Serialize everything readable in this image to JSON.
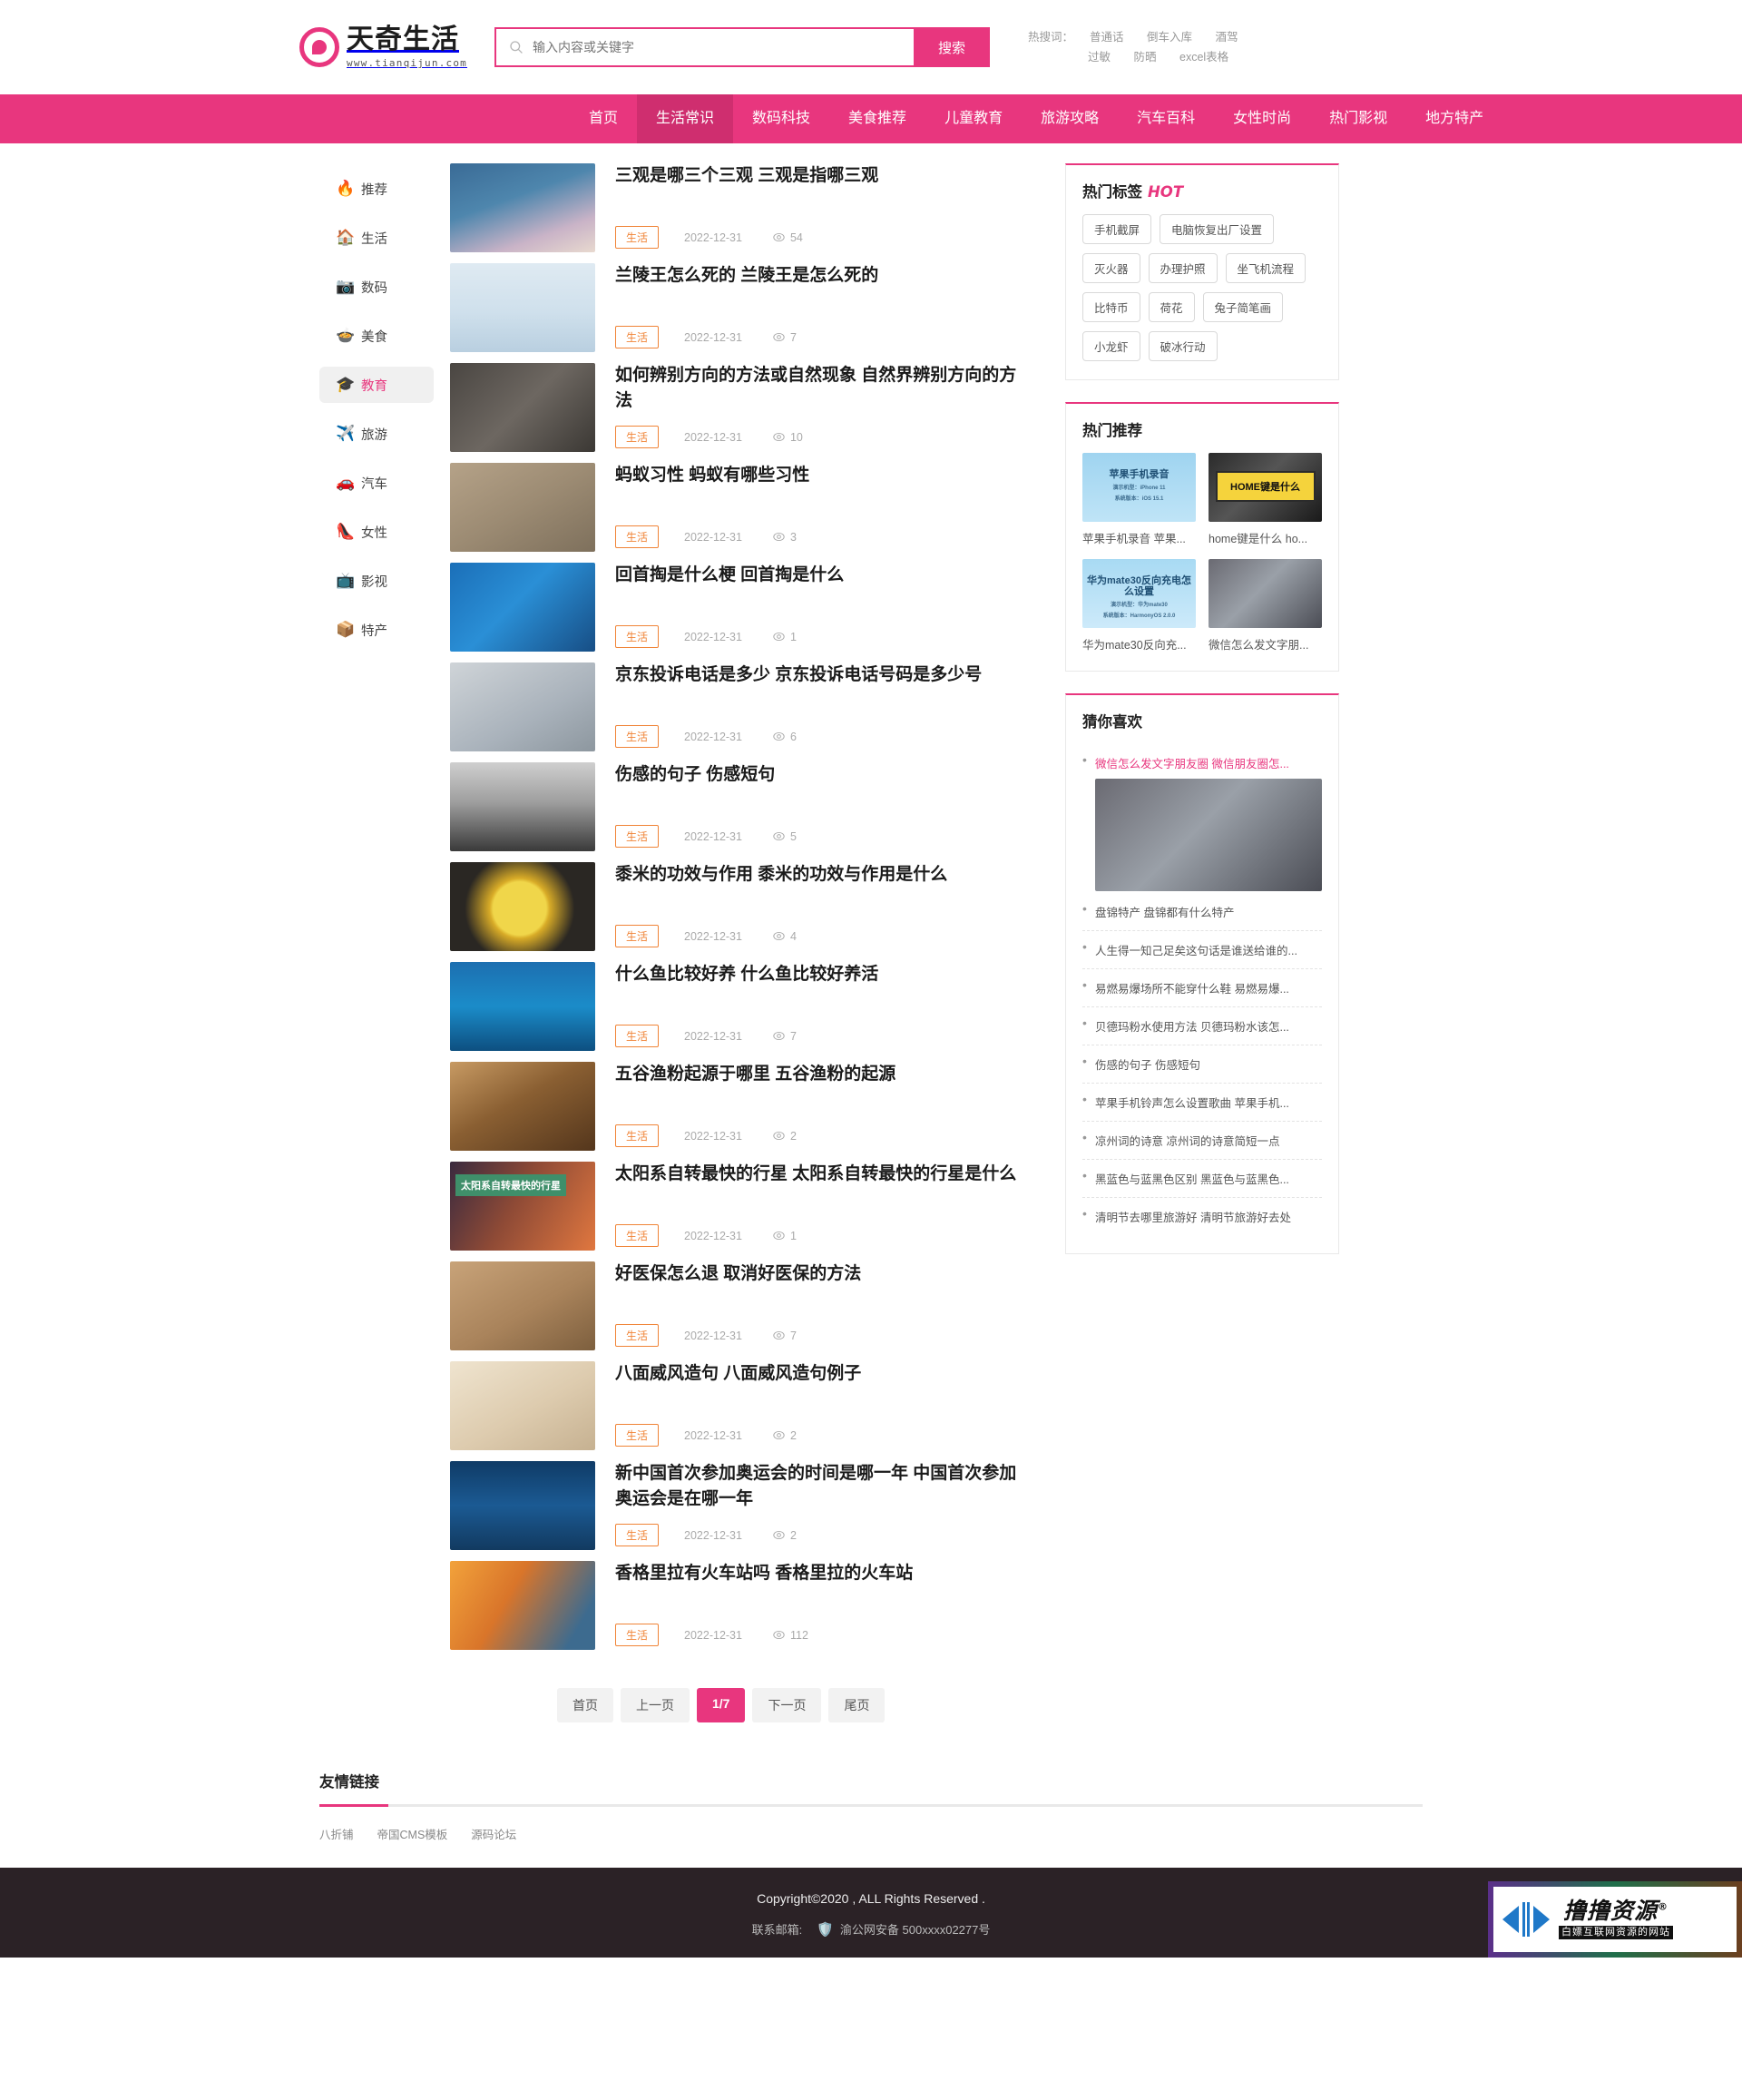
{
  "site": {
    "logo_title": "天奇生活",
    "logo_sub": "www.tianqijun.com"
  },
  "search": {
    "placeholder": "输入内容或关键字",
    "value": "",
    "button_label": "搜索"
  },
  "hotwords": {
    "label": "热搜词：",
    "row1": [
      "普通话",
      "倒车入库",
      "酒驾"
    ],
    "row2": [
      "过敏",
      "防晒",
      "excel表格"
    ]
  },
  "nav": {
    "items": [
      {
        "label": "首页",
        "active": false
      },
      {
        "label": "生活常识",
        "active": true
      },
      {
        "label": "数码科技",
        "active": false
      },
      {
        "label": "美食推荐",
        "active": false
      },
      {
        "label": "儿童教育",
        "active": false
      },
      {
        "label": "旅游攻略",
        "active": false
      },
      {
        "label": "汽车百科",
        "active": false
      },
      {
        "label": "女性时尚",
        "active": false
      },
      {
        "label": "热门影视",
        "active": false
      },
      {
        "label": "地方特产",
        "active": false
      }
    ]
  },
  "categories": [
    {
      "icon": "🔥",
      "label": "推荐",
      "active": false
    },
    {
      "icon": "🏠",
      "label": "生活",
      "active": false
    },
    {
      "icon": "📷",
      "label": "数码",
      "active": false
    },
    {
      "icon": "🍲",
      "label": "美食",
      "active": false
    },
    {
      "icon": "🎓",
      "label": "教育",
      "active": true
    },
    {
      "icon": "✈️",
      "label": "旅游",
      "active": false
    },
    {
      "icon": "🚗",
      "label": "汽车",
      "active": false
    },
    {
      "icon": "👠",
      "label": "女性",
      "active": false
    },
    {
      "icon": "📺",
      "label": "影视",
      "active": false
    },
    {
      "icon": "📦",
      "label": "特产",
      "active": false
    }
  ],
  "articles": [
    {
      "title": "三观是哪三个三观 三观是指哪三观",
      "tag": "生活",
      "date": "2022-12-31",
      "views": "54",
      "thumb": "book-blue"
    },
    {
      "title": "兰陵王怎么死的 兰陵王是怎么死的",
      "tag": "生活",
      "date": "2022-12-31",
      "views": "7",
      "thumb": "ancient-man"
    },
    {
      "title": "如何辨别方向的方法或自然现象 自然界辨别方向的方法",
      "tag": "生活",
      "date": "2022-12-31",
      "views": "10",
      "thumb": "arrows"
    },
    {
      "title": "蚂蚁习性 蚂蚁有哪些习性",
      "tag": "生活",
      "date": "2022-12-31",
      "views": "3",
      "thumb": "ant"
    },
    {
      "title": "回首掏是什么梗 回首掏是什么",
      "tag": "生活",
      "date": "2022-12-31",
      "views": "1",
      "thumb": "gaming"
    },
    {
      "title": "京东投诉电话是多少 京东投诉电话号码是多少号",
      "tag": "生活",
      "date": "2022-12-31",
      "views": "6",
      "thumb": "tech-hand"
    },
    {
      "title": "伤感的句子 伤感短句",
      "tag": "生活",
      "date": "2022-12-31",
      "views": "5",
      "thumb": "silhouette"
    },
    {
      "title": "黍米的功效与作用 黍米的功效与作用是什么",
      "tag": "生活",
      "date": "2022-12-31",
      "views": "4",
      "thumb": "millet"
    },
    {
      "title": "什么鱼比较好养 什么鱼比较好养活",
      "tag": "生活",
      "date": "2022-12-31",
      "views": "7",
      "thumb": "fish"
    },
    {
      "title": "五谷渔粉起源于哪里 五谷渔粉的起源",
      "tag": "生活",
      "date": "2022-12-31",
      "views": "2",
      "thumb": "noodle"
    },
    {
      "title": "太阳系自转最快的行星 太阳系自转最快的行星是什么",
      "tag": "生活",
      "date": "2022-12-31",
      "views": "1",
      "thumb": "planet",
      "thumb_text": "太阳系自转最快的行星"
    },
    {
      "title": "好医保怎么退 取消好医保的方法",
      "tag": "生活",
      "date": "2022-12-31",
      "views": "7",
      "thumb": "phone-apps"
    },
    {
      "title": "八面威风造句 八面威风造句例子",
      "tag": "生活",
      "date": "2022-12-31",
      "views": "2",
      "thumb": "book-leaf"
    },
    {
      "title": "新中国首次参加奥运会的时间是哪一年 中国首次参加奥运会是在哪一年",
      "tag": "生活",
      "date": "2022-12-31",
      "views": "2",
      "thumb": "medal"
    },
    {
      "title": "香格里拉有火车站吗 香格里拉的火车站",
      "tag": "生活",
      "date": "2022-12-31",
      "views": "112",
      "thumb": "train"
    }
  ],
  "pagination": {
    "first": "首页",
    "prev": "上一页",
    "current": "1/7",
    "next": "下一页",
    "last": "尾页"
  },
  "hot_tags": {
    "title": "热门标签",
    "badge": "HOT",
    "items": [
      "手机截屏",
      "电脑恢复出厂设置",
      "灭火器",
      "办理护照",
      "坐飞机流程",
      "比特币",
      "荷花",
      "兔子简笔画",
      "小龙虾",
      "破冰行动"
    ]
  },
  "hot_recs": {
    "title": "热门推荐",
    "items": [
      {
        "caption": "苹果手机录音 苹果...",
        "thumb": "iphone-record",
        "thumb_text": "苹果手机录音",
        "thumb_sub1": "演示机型：iPhone 11",
        "thumb_sub2": "系统版本：iOS 15.1"
      },
      {
        "caption": "home键是什么 ho...",
        "thumb": "home-key",
        "thumb_text": "HOME键是什么"
      },
      {
        "caption": "华为mate30反向充...",
        "thumb": "huawei",
        "thumb_text": "华为mate30反向充电怎么设置",
        "thumb_sub1": "演示机型：华为mate30",
        "thumb_sub2": "系统版本：HarmonyOS 2.0.0"
      },
      {
        "caption": "微信怎么发文字朋...",
        "thumb": "wechat-hand"
      }
    ]
  },
  "guess_like": {
    "title": "猜你喜欢",
    "items": [
      {
        "text": "微信怎么发文字朋友圈 微信朋友圈怎...",
        "highlight": true,
        "image": "wechat-hand"
      },
      {
        "text": "盘锦特产 盘锦都有什么特产",
        "highlight": false
      },
      {
        "text": "人生得一知己足矣这句话是谁送给谁的...",
        "highlight": false
      },
      {
        "text": "易燃易爆场所不能穿什么鞋 易燃易爆...",
        "highlight": false
      },
      {
        "text": "贝德玛粉水使用方法 贝德玛粉水该怎...",
        "highlight": false
      },
      {
        "text": "伤感的句子 伤感短句",
        "highlight": false
      },
      {
        "text": "苹果手机铃声怎么设置歌曲 苹果手机...",
        "highlight": false
      },
      {
        "text": "凉州词的诗意 凉州词的诗意简短一点",
        "highlight": false
      },
      {
        "text": "黑蓝色与蓝黑色区别 黑蓝色与蓝黑色...",
        "highlight": false
      },
      {
        "text": "清明节去哪里旅游好 清明节旅游好去处",
        "highlight": false
      }
    ]
  },
  "friend_links": {
    "title": "友情链接",
    "items": [
      "八折铺",
      "帝国CMS模板",
      "源码论坛"
    ]
  },
  "footer": {
    "copyright": "Copyright©2020 , ALL Rights Reserved .",
    "email_label": "联系邮箱:",
    "beian": "渝公网安备 500xxxx02277号"
  },
  "watermark": {
    "title": "撸撸资源",
    "reg": "®",
    "sub": "白嫖互联网资源的网站"
  },
  "colors": {
    "brand": "#e8367e",
    "nav_active": "#cf2e6f",
    "tag_orange": "#f08437"
  }
}
